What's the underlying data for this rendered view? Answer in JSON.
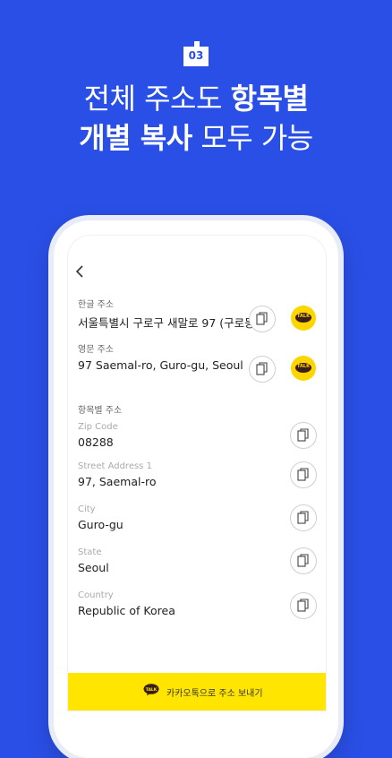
{
  "step_badge": "03",
  "headline": {
    "line1_regular": "전체 주소도 ",
    "line1_bold": "항목별",
    "line2_bold": "개별 복사",
    "line2_regular": " 모두 가능"
  },
  "screen": {
    "korean_address": {
      "label": "한글 주소",
      "value": "서울특별시 구로구 새말로 97 (구로동)"
    },
    "english_address": {
      "label": "영문 주소",
      "value": "97 Saemal-ro, Guro-gu, Seoul"
    },
    "itemized": {
      "title": "항목별 주소",
      "fields": [
        {
          "label": "Zip Code",
          "value": "08288"
        },
        {
          "label": "Street Address 1",
          "value": "97, Saemal-ro"
        },
        {
          "label": "City",
          "value": "Guro-gu"
        },
        {
          "label": "State",
          "value": "Seoul"
        },
        {
          "label": "Country",
          "value": "Republic of Korea"
        }
      ]
    },
    "talk_badge": "TALK",
    "cta": {
      "icon_label": "TALK",
      "label": "카카오톡으로 주소 보내기"
    }
  },
  "colors": {
    "background": "#2a4fe6",
    "kakao_yellow": "#ffe500",
    "kakao_brown": "#3a1d1d"
  },
  "icons": {
    "back": "chevron-left-icon",
    "copy": "copy-icon",
    "kakao": "kakao-talk-icon",
    "badge": "house-icon"
  }
}
